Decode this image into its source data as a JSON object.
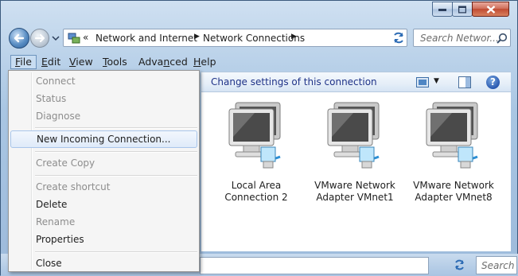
{
  "window": {
    "caption_buttons": [
      "minimize-icon",
      "maximize-icon",
      "close-icon"
    ]
  },
  "nav": {
    "back_icon": "back-arrow-icon",
    "forward_icon": "forward-arrow-icon"
  },
  "address": {
    "overflow": "«",
    "crumbs": [
      "Network and Internet",
      "Network Connections"
    ],
    "separator": "▶"
  },
  "search": {
    "placeholder": "Search Networ...",
    "lower_placeholder": "Search W"
  },
  "menubar": {
    "items": [
      {
        "label": "File",
        "accel": "F",
        "rest": "ile"
      },
      {
        "label": "Edit",
        "accel": "E",
        "rest": "dit"
      },
      {
        "label": "View",
        "accel": "V",
        "rest": "iew"
      },
      {
        "label": "Tools",
        "accel": "T",
        "rest": "ools"
      },
      {
        "label": "Advanced",
        "pre": "Adva",
        "accel": "n",
        "rest": "ced"
      },
      {
        "label": "Help",
        "accel": "H",
        "rest": "elp"
      }
    ]
  },
  "commandbar": {
    "change_settings": "Change settings of this connection"
  },
  "connections": [
    {
      "line1": "Local Area",
      "line2": "Connection 2"
    },
    {
      "line1": "VMware Network",
      "line2": "Adapter VMnet1"
    },
    {
      "line1": "VMware Network",
      "line2": "Adapter VMnet8"
    }
  ],
  "file_menu": {
    "connect": "Connect",
    "status": "Status",
    "diagnose": "Diagnose",
    "new_incoming": "New Incoming Connection...",
    "create_copy": "Create Copy",
    "create_shortcut": "Create shortcut",
    "delete": "Delete",
    "rename": "Rename",
    "properties": "Properties",
    "close": "Close"
  },
  "colors": {
    "accent_link": "#1e3287",
    "disabled_text": "#8d8d8d",
    "highlight_border": "#a8c5ea"
  }
}
